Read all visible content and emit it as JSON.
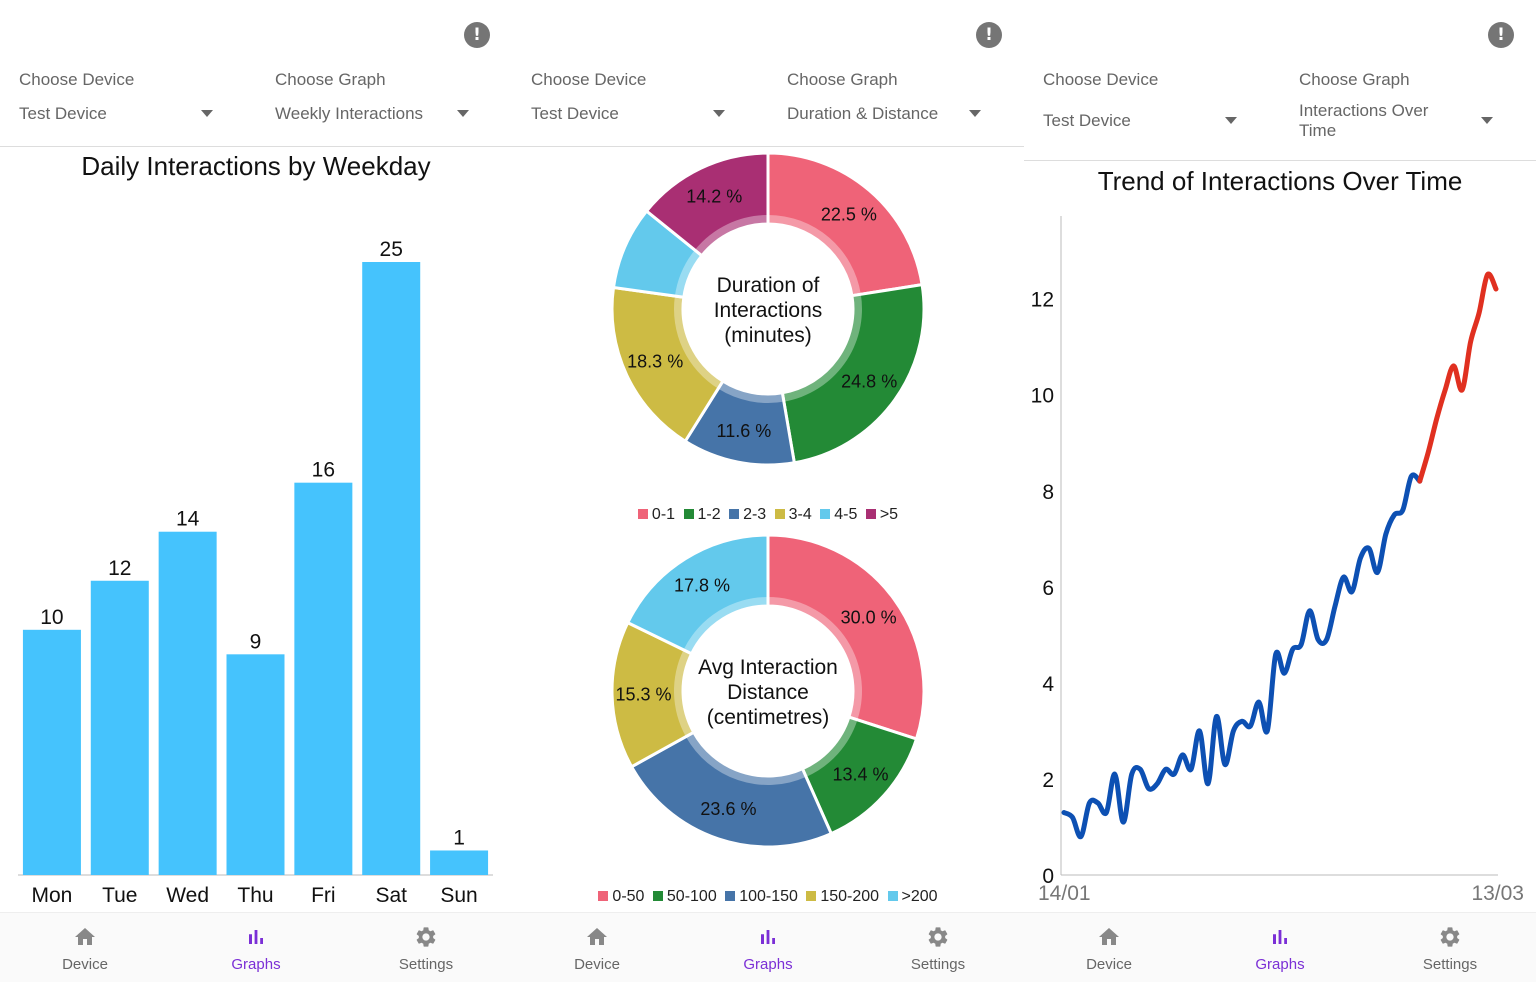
{
  "colors": {
    "accent": "#7b2fd6",
    "bar": "#45c3fd",
    "line_blue": "#0d50b3",
    "line_red": "#e03020",
    "slices_duration": [
      "#ef6378",
      "#238a36",
      "#4674a8",
      "#cdbb44",
      "#63c9ec",
      "#a92f73"
    ],
    "slices_distance": [
      "#ef6378",
      "#238a36",
      "#4674a8",
      "#cdbb44",
      "#63c9ec"
    ]
  },
  "panels": [
    {
      "alert_icon": "!",
      "device_label": "Choose Device",
      "device_value": "Test Device",
      "graph_label": "Choose Graph",
      "graph_value": "Weekly Interactions"
    },
    {
      "alert_icon": "!",
      "device_label": "Choose Device",
      "device_value": "Test Device",
      "graph_label": "Choose Graph",
      "graph_value": "Duration & Distance"
    },
    {
      "alert_icon": "!",
      "device_label": "Choose Device",
      "device_value": "Test Device",
      "graph_label": "Choose Graph",
      "graph_value_line1": "Interactions Over",
      "graph_value_line2": "Time"
    }
  ],
  "nav": {
    "device": "Device",
    "graphs": "Graphs",
    "settings": "Settings",
    "icons": [
      "home-icon",
      "bar-chart-icon",
      "gear-icon"
    ],
    "active": "graphs"
  },
  "chart_data": [
    {
      "type": "bar",
      "title": "Daily Interactions by Weekday",
      "categories": [
        "Mon",
        "Tue",
        "Wed",
        "Thu",
        "Fri",
        "Sat",
        "Sun"
      ],
      "values": [
        10,
        12,
        14,
        9,
        16,
        25,
        1
      ],
      "ylim": [
        0,
        25
      ],
      "grid": false
    },
    {
      "type": "pie",
      "center_line1": "Duration of",
      "center_line2": "Interactions",
      "center_line3": "(minutes)",
      "categories": [
        "0-1",
        "1-2",
        "2-3",
        "3-4",
        "4-5",
        ">5"
      ],
      "values": [
        22.5,
        24.8,
        11.6,
        18.3,
        8.6,
        14.2
      ],
      "labels": [
        "22.5 %",
        "24.8 %",
        "11.6 %",
        "18.3 %",
        "",
        "14.2 %"
      ],
      "legend_position": "bottom"
    },
    {
      "type": "pie",
      "center_line1": "Avg Interaction",
      "center_line2": "Distance",
      "center_line3": "(centimetres)",
      "categories": [
        "0-50",
        "50-100",
        "100-150",
        "150-200",
        ">200"
      ],
      "values": [
        30.0,
        13.4,
        23.6,
        15.3,
        17.8
      ],
      "labels": [
        "30.0 %",
        "13.4 %",
        "23.6 %",
        "15.3 %",
        "17.8 %"
      ],
      "legend_position": "bottom"
    },
    {
      "type": "line",
      "title": "Trend of Interactions Over Time",
      "x_start": "14/01",
      "x_end": "13/03",
      "ylim": [
        0,
        13.2
      ],
      "yticks": [
        "0",
        "2",
        "4",
        "6",
        "8",
        "10",
        "12"
      ],
      "grid": false,
      "series": [
        {
          "values": [
            1.3,
            1.2,
            0.8,
            1.5,
            1.5,
            1.3,
            2.1,
            1.1,
            2.1,
            2.2,
            1.8,
            1.9,
            2.2,
            2.1,
            2.5,
            2.2,
            3.0,
            1.9,
            3.3,
            2.3,
            3.0,
            3.2,
            3.1,
            3.6,
            3.0,
            4.6,
            4.2,
            4.7,
            4.8,
            5.5,
            4.9,
            4.9,
            5.6,
            6.2,
            5.9,
            6.6,
            6.8,
            6.3,
            7.1,
            7.5,
            7.6,
            8.3,
            8.2
          ]
        },
        {
          "values": [
            8.2,
            8.8,
            9.5,
            10.1,
            10.6,
            10.1,
            11.1,
            11.7,
            12.5,
            12.2
          ]
        }
      ]
    }
  ]
}
